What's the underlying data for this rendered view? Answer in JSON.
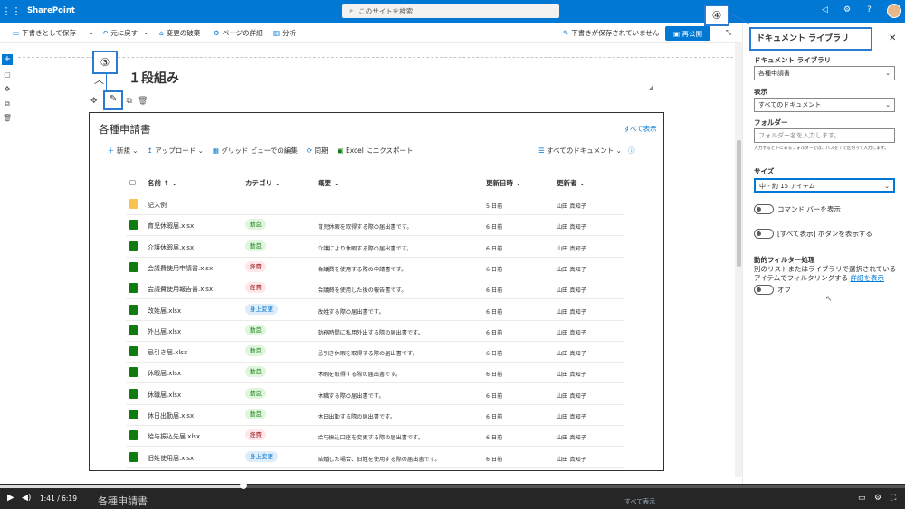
{
  "suite": {
    "brand": "SharePoint",
    "search_placeholder": "このサイトを検索"
  },
  "cmdbar": {
    "save_draft": "下書きとして保存",
    "undo": "元に戻す",
    "discard": "変更の破棄",
    "page_details": "ページの詳細",
    "analytics": "分析",
    "draft_status": "下書きが保存されていません",
    "republish": "再公開"
  },
  "section": {
    "title": "１段組み"
  },
  "callouts": {
    "three": "③",
    "four": "④"
  },
  "webpart": {
    "title": "各種申請書",
    "see_all": "すべて表示",
    "commands": [
      "新規",
      "アップロード",
      "グリッド ビューでの編集",
      "同期",
      "Excel にエクスポート"
    ],
    "view": "すべてのドキュメント",
    "headers": {
      "name": "名前 ↑",
      "category": "カテゴリ",
      "summary": "概要",
      "modified": "更新日時",
      "modified_by": "更新者"
    },
    "rows": [
      {
        "name": "記入例",
        "category": "",
        "summary": "",
        "modified": "5 日前",
        "by": "山田 真知子",
        "folder": true
      },
      {
        "name": "育児休暇届.xlsx",
        "category": "勤怠",
        "summary": "育児休暇を取得する際の届出書です。",
        "modified": "6 日前",
        "by": "山田 真知子"
      },
      {
        "name": "介護休暇届.xlsx",
        "category": "勤怠",
        "summary": "介護により休暇する際の届出書です。",
        "modified": "6 日前",
        "by": "山田 真知子"
      },
      {
        "name": "会議費使用申請書.xlsx",
        "category": "経費",
        "summary": "会議費を使用する際の申請書です。",
        "modified": "6 日前",
        "by": "山田 真知子"
      },
      {
        "name": "会議費使用報告書.xlsx",
        "category": "経費",
        "summary": "会議費を使用した後の報告書です。",
        "modified": "6 日前",
        "by": "山田 真知子"
      },
      {
        "name": "改姓届.xlsx",
        "category": "身上変更",
        "summary": "改姓する際の届出書です。",
        "modified": "6 日前",
        "by": "山田 真知子"
      },
      {
        "name": "外出届.xlsx",
        "category": "勤怠",
        "summary": "勤務時間に私用外出する際の届出書です。",
        "modified": "6 日前",
        "by": "山田 真知子"
      },
      {
        "name": "忌引き届.xlsx",
        "category": "勤怠",
        "summary": "忌引き休暇を取得する際の届出書です。",
        "modified": "6 日前",
        "by": "山田 真知子"
      },
      {
        "name": "休暇届.xlsx",
        "category": "勤怠",
        "summary": "休暇を取得する際の届出書です。",
        "modified": "6 日前",
        "by": "山田 真知子"
      },
      {
        "name": "休職届.xlsx",
        "category": "勤怠",
        "summary": "休職する際の届出書です。",
        "modified": "6 日前",
        "by": "山田 真知子"
      },
      {
        "name": "休日出勤届.xlsx",
        "category": "勤怠",
        "summary": "休日出勤する際の届出書です。",
        "modified": "6 日前",
        "by": "山田 真知子"
      },
      {
        "name": "給与振込先届.xlsx",
        "category": "経費",
        "summary": "給与振込口座を変更する際の届出書です。",
        "modified": "6 日前",
        "by": "山田 真知子"
      },
      {
        "name": "旧姓使用届.xlsx",
        "category": "身上変更",
        "summary": "結婚した場合、旧姓を使用する際の届出書です。",
        "modified": "6 日前",
        "by": "山田 真知子"
      }
    ],
    "below_title": "各種申請書",
    "below_see_all": "すべて表示"
  },
  "category_colors": {
    "勤怠": "#dff6dd",
    "経費": "#fde7e9",
    "身上変更": "#deecf9"
  },
  "category_text": {
    "勤怠": "#107c10",
    "経費": "#a4262c",
    "身上変更": "#0078d4"
  },
  "panel": {
    "title": "ドキュメント ライブラリ",
    "library_label": "ドキュメント ライブラリ",
    "library_value": "各種申請書",
    "view_label": "表示",
    "view_value": "すべてのドキュメント",
    "folder_label": "フォルダー",
    "folder_placeholder": "フォルダー名を入力します。",
    "folder_help": "入力すると下にあるフォルダーでは、パスを / で区切って入力します。",
    "size_label": "サイズ",
    "size_value": "中 - 約 15 アイテム",
    "toggle_command": "コマンド バーを表示",
    "toggle_seeall": "[すべて表示] ボタンを表示する",
    "dynamic_label": "動的フィルター処理",
    "dynamic_desc1": "別のリストまたはライブラリで選択されている",
    "dynamic_desc2": "アイテムでフィルタリングする",
    "dynamic_link": "詳細を表示",
    "dynamic_state": "オフ"
  },
  "player": {
    "time": "1:41 / 6:19",
    "progress": 0.269
  }
}
